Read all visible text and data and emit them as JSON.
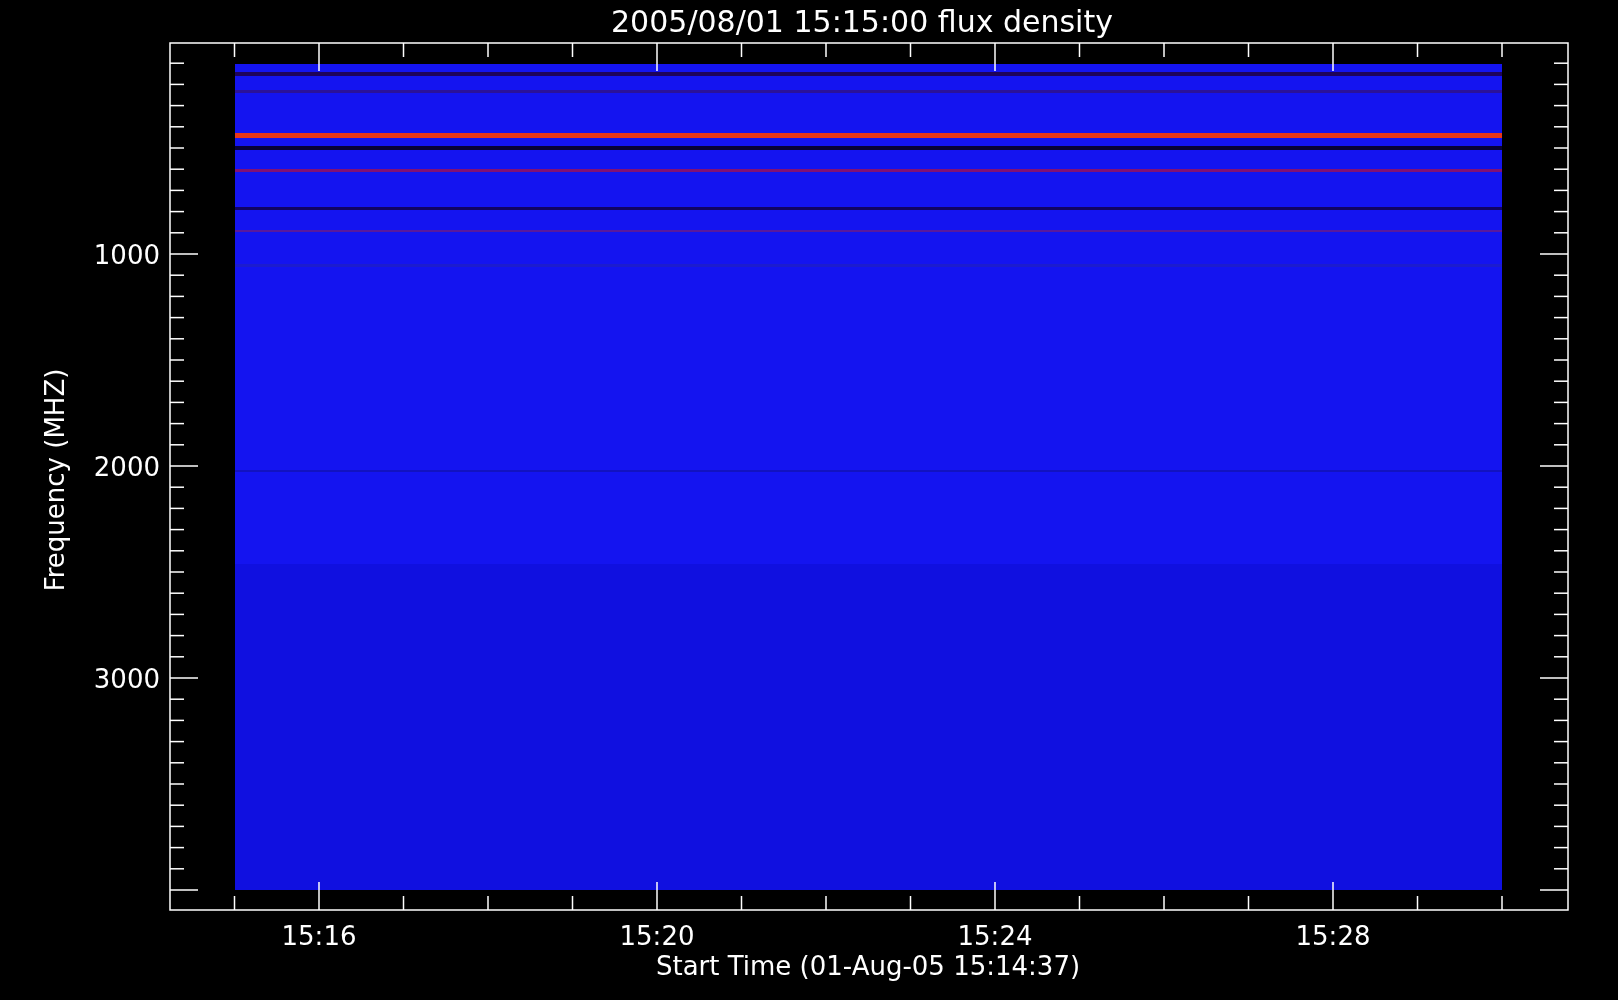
{
  "title": "2005/08/01 15:15:00 flux density",
  "y_axis": {
    "label": "Frequency (MHZ)",
    "ticks": [
      "1000",
      "2000",
      "3000"
    ]
  },
  "x_axis": {
    "label": "Start Time (01-Aug-05 15:14:37)",
    "ticks": [
      "15:16",
      "15:20",
      "15:24",
      "15:28"
    ]
  }
}
